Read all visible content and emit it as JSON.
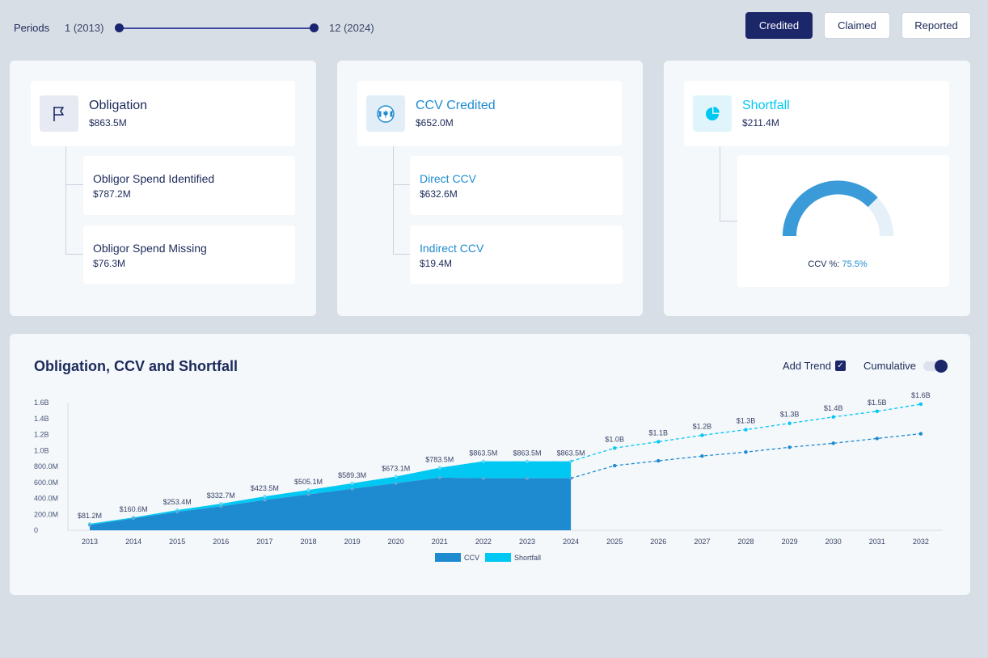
{
  "periods": {
    "label": "Periods",
    "start": "1 (2013)",
    "end": "12 (2024)"
  },
  "buttons": [
    {
      "label": "Credited",
      "active": true
    },
    {
      "label": "Claimed",
      "active": false
    },
    {
      "label": "Reported",
      "active": false
    }
  ],
  "cards": {
    "obligation": {
      "title": "Obligation",
      "value": "$863.5M",
      "icon": "flag-icon",
      "items": [
        {
          "label": "Obligor Spend Identified",
          "value": "$787.2M"
        },
        {
          "label": "Obligor Spend Missing",
          "value": "$76.3M"
        }
      ]
    },
    "ccv": {
      "title": "CCV Credited",
      "value": "$652.0M",
      "icon": "canada-flag-icon",
      "items": [
        {
          "label": "Direct CCV",
          "value": "$632.6M"
        },
        {
          "label": "Indirect CCV",
          "value": "$19.4M"
        }
      ]
    },
    "shortfall": {
      "title": "Shortfall",
      "value": "$211.4M",
      "icon": "pie-chart-icon",
      "gauge_label": "CCV %:",
      "gauge_value": "75.5%",
      "gauge_pct": 75.5
    }
  },
  "chart": {
    "title": "Obligation, CCV and Shortfall",
    "add_trend_label": "Add Trend",
    "add_trend_checked": true,
    "cumulative_label": "Cumulative",
    "cumulative_on": true
  },
  "colors": {
    "ccv": "#1e8bd0",
    "shortfall": "#00c8f2",
    "navy": "#1b2769"
  },
  "chart_data": {
    "type": "area",
    "title": "Obligation, CCV and Shortfall",
    "y_ticks": [
      "1.6B",
      "1.4B",
      "1.2B",
      "1.0B",
      "800.0M",
      "600.0M",
      "400.0M",
      "200.0M",
      "0"
    ],
    "ylim": [
      0,
      1600
    ],
    "x": [
      "2013",
      "2014",
      "2015",
      "2016",
      "2017",
      "2018",
      "2019",
      "2020",
      "2021",
      "2022",
      "2023",
      "2024",
      "2025",
      "2026",
      "2027",
      "2028",
      "2029",
      "2030",
      "2031",
      "2032"
    ],
    "series": [
      {
        "name": "CCV",
        "values": [
          66,
          150,
          230,
          300,
          380,
          450,
          520,
          590,
          660,
          652,
          652,
          652
        ]
      },
      {
        "name": "Shortfall",
        "values": [
          15,
          11,
          23,
          33,
          44,
          55,
          69,
          83,
          124,
          212,
          212,
          212
        ]
      }
    ],
    "total_labels": [
      "$81.2M",
      "$160.6M",
      "$253.4M",
      "$332.7M",
      "$423.5M",
      "$505.1M",
      "$589.3M",
      "$673.1M",
      "$783.5M",
      "$863.5M",
      "$863.5M",
      "$863.5M"
    ],
    "trend_total": {
      "values": [
        1030,
        1110,
        1190,
        1260,
        1340,
        1420,
        1490,
        1580
      ],
      "labels": [
        "$1.0B",
        "$1.1B",
        "$1.2B",
        "$1.3B",
        "$1.3B",
        "$1.4B",
        "$1.5B",
        "$1.6B"
      ]
    },
    "trend_ccv": {
      "values": [
        810,
        870,
        930,
        980,
        1040,
        1090,
        1150,
        1210
      ]
    },
    "legend": [
      "CCV",
      "Shortfall"
    ],
    "legend_position": "bottom-center"
  }
}
